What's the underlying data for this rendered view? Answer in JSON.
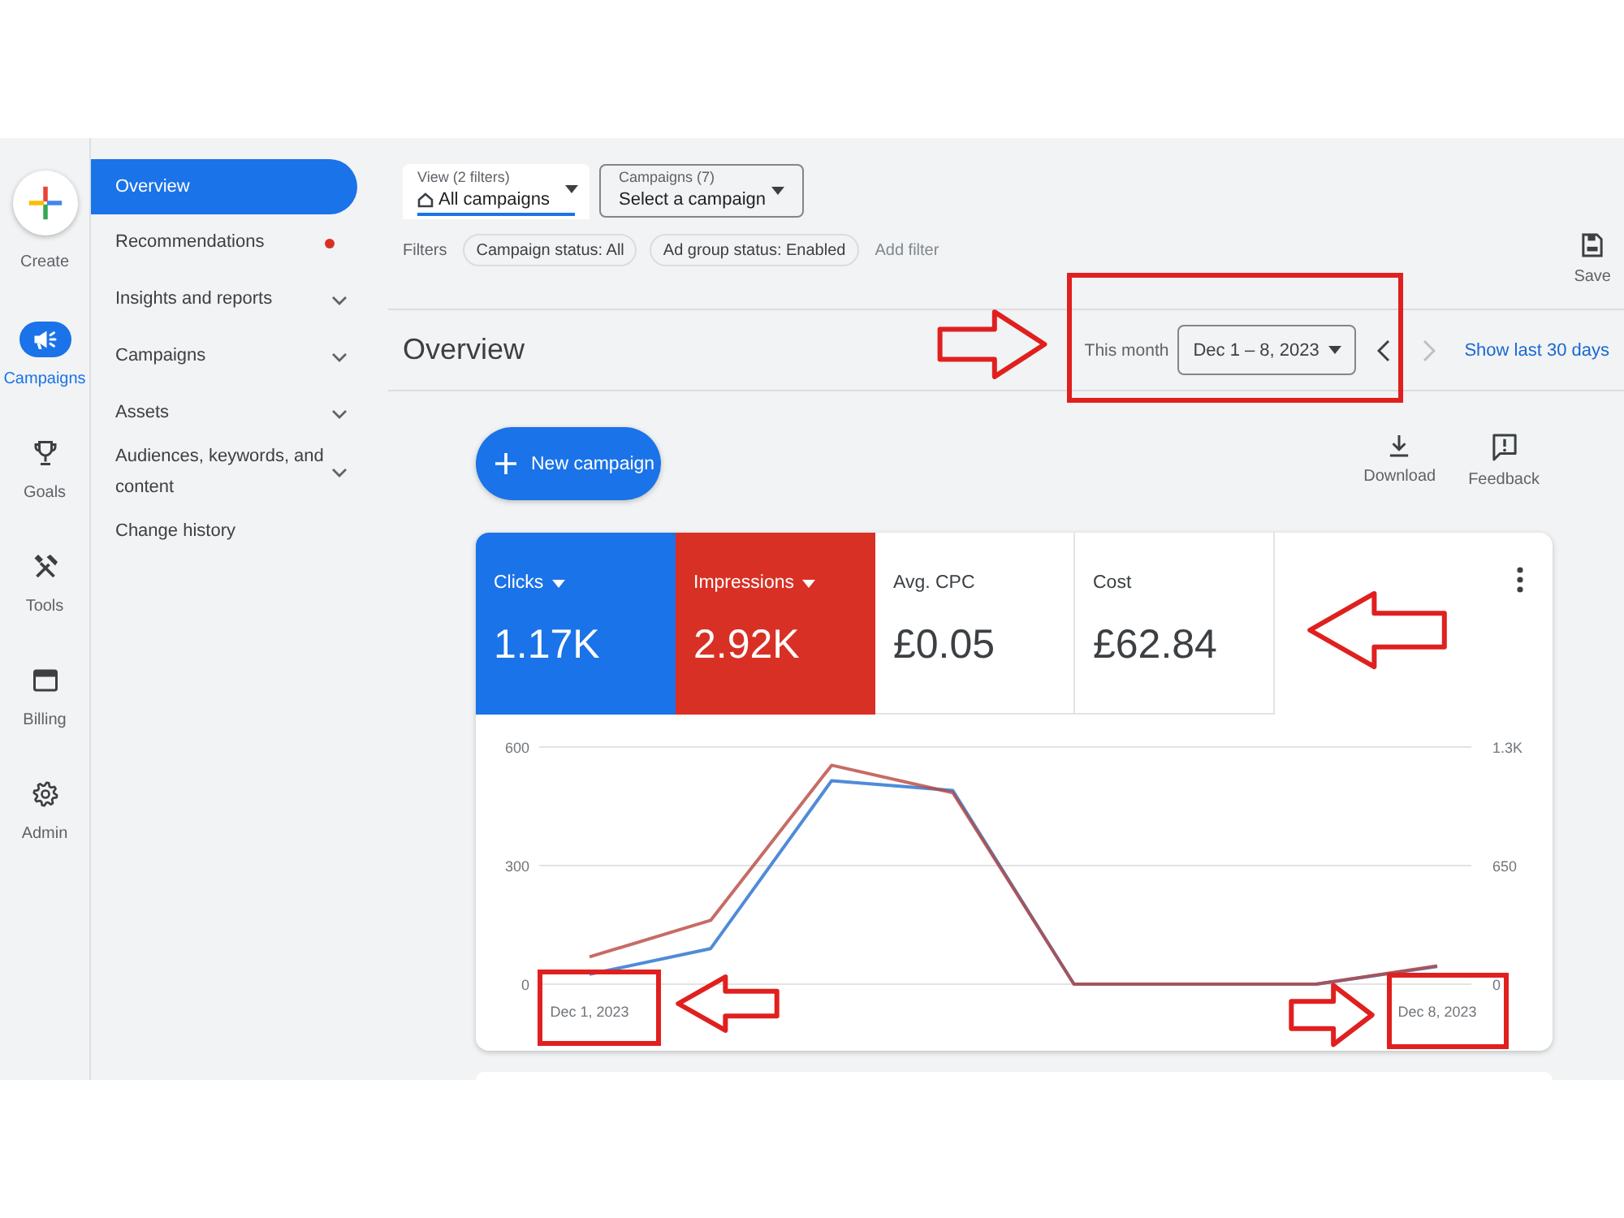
{
  "rail": {
    "create": {
      "label": "Create"
    },
    "items": [
      {
        "label": "Campaigns",
        "selected": true
      },
      {
        "label": "Goals",
        "selected": false
      },
      {
        "label": "Tools",
        "selected": false
      },
      {
        "label": "Billing",
        "selected": false
      },
      {
        "label": "Admin",
        "selected": false
      }
    ]
  },
  "nav": {
    "items": [
      {
        "label": "Overview",
        "kind": "page",
        "selected": true
      },
      {
        "label": "Recommendations",
        "kind": "alert",
        "selected": false
      },
      {
        "label": "Insights and reports",
        "kind": "group",
        "selected": false,
        "expanded": false
      },
      {
        "label": "Campaigns",
        "kind": "group",
        "selected": false,
        "expanded": false
      },
      {
        "label": "Assets",
        "kind": "group",
        "selected": false,
        "expanded": false
      },
      {
        "label": "Audiences, keywords, and content",
        "kind": "group",
        "selected": false,
        "expanded": false
      },
      {
        "label": "Change history",
        "kind": "page",
        "selected": false
      }
    ]
  },
  "toolbar": {
    "view": {
      "caption": "View (2 filters)",
      "value": "All campaigns"
    },
    "campaign_picker": {
      "caption": "Campaigns (7)",
      "value": "Select a campaign"
    },
    "filters": {
      "label": "Filters",
      "chips": [
        "Campaign status: All",
        "Ad group status: Enabled"
      ],
      "add": "Add filter"
    },
    "save": "Save"
  },
  "header": {
    "title": "Overview",
    "date_preset": "This month",
    "date_range": "Dec 1 – 8, 2023",
    "prev": {
      "disabled": false
    },
    "next": {
      "disabled": true
    },
    "quick_link": "Show last 30 days"
  },
  "actions": {
    "new_campaign": "New campaign",
    "buttons": [
      {
        "label": "Download"
      },
      {
        "label": "Feedback"
      }
    ]
  },
  "overview_card": {
    "metrics": [
      {
        "label": "Clicks",
        "value": "1.17K",
        "selected": true,
        "color": "#1a73e8"
      },
      {
        "label": "Impressions",
        "value": "2.92K",
        "selected": true,
        "color": "#d93025"
      },
      {
        "label": "Avg. CPC",
        "value": "£0.05",
        "selected": false
      },
      {
        "label": "Cost",
        "value": "£62.84",
        "selected": false
      }
    ],
    "chart_data": {
      "type": "line",
      "categories": [
        "Dec 1, 2023",
        null,
        null,
        null,
        null,
        null,
        null,
        "Dec 8, 2023"
      ],
      "ylim": [
        0,
        600
      ],
      "yticks": [
        0,
        300,
        600
      ],
      "y2lim": [
        0,
        1300
      ],
      "y2ticks": [
        0,
        650,
        {
          "value": 1300,
          "label": "1.3K"
        }
      ],
      "series": [
        {
          "color": "#4f8bd8",
          "values": [
            25,
            90,
            515,
            490,
            0,
            0,
            0,
            45
          ]
        },
        {
          "color": "#b8473f",
          "axis": "y2",
          "values": [
            150,
            350,
            1200,
            1050,
            0,
            0,
            0,
            100
          ]
        }
      ]
    }
  }
}
